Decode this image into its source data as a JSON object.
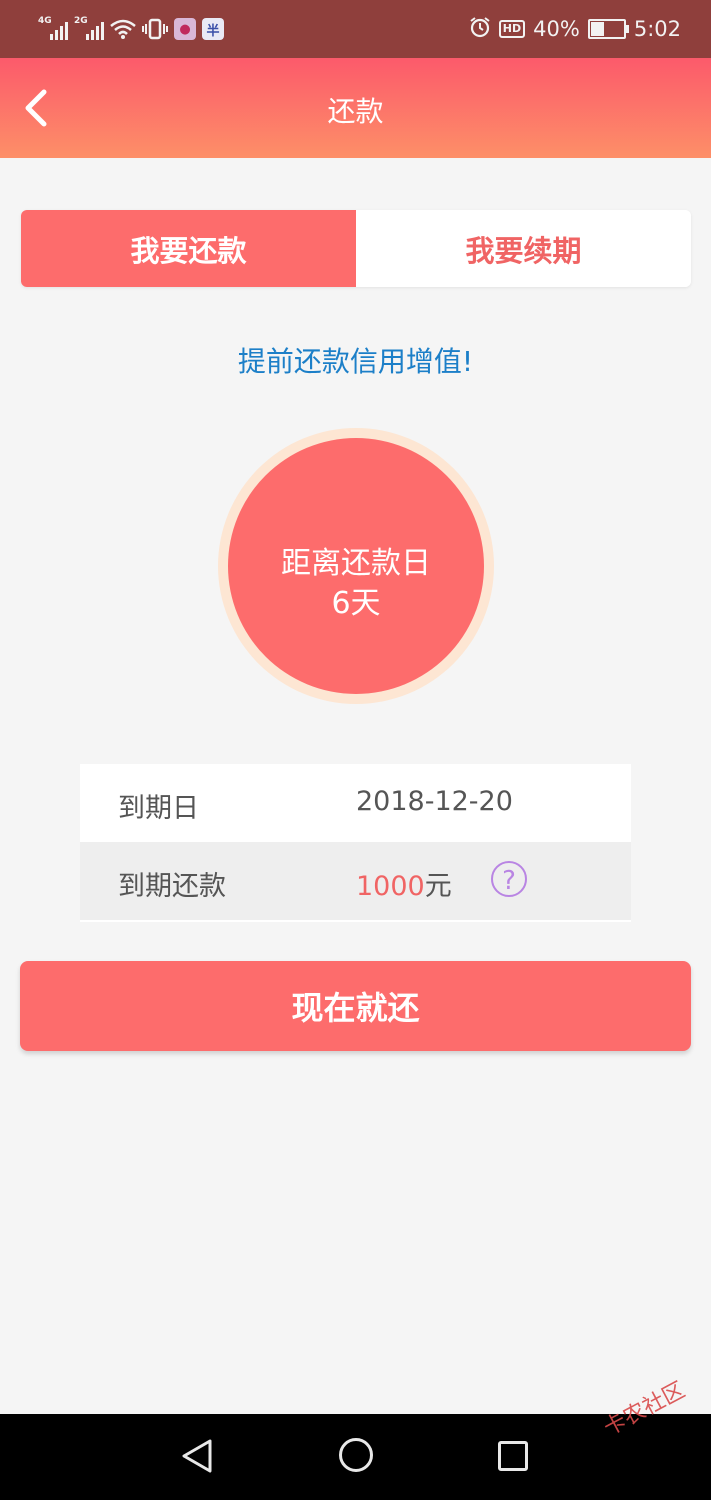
{
  "status_bar": {
    "signal1_label": "4G",
    "signal2_label": "2G",
    "app_icon_2": "半",
    "hd_label": "HD",
    "battery_percent": "40%",
    "battery_level": 0.4,
    "time": "5:02"
  },
  "header": {
    "title": "还款",
    "back_icon": "chevron-left-icon"
  },
  "tabs": [
    {
      "label": "我要还款",
      "active": true
    },
    {
      "label": "我要续期",
      "active": false
    }
  ],
  "slogan": "提前还款信用增值!",
  "countdown": {
    "label": "距离还款日",
    "value": "6天"
  },
  "info": {
    "due_date_label": "到期日",
    "due_date_value": "2018-12-20",
    "amount_label": "到期还款",
    "amount_number": "1000",
    "amount_unit": "元",
    "help_icon": "?"
  },
  "pay_button": "现在就还",
  "watermark": "卡农社区",
  "colors": {
    "primary": "#fd6c6c",
    "header_gradient_top": "#fc5a6b",
    "header_gradient_bottom": "#fd8f68",
    "slogan": "#1c7fc8",
    "help_icon": "#b985e3"
  }
}
